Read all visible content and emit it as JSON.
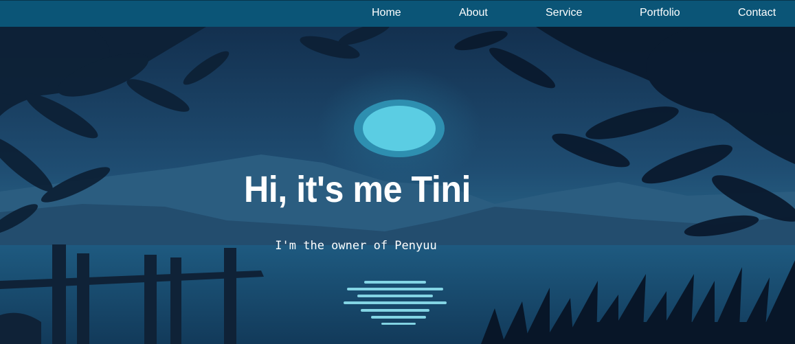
{
  "nav": {
    "items": [
      {
        "label": "Home"
      },
      {
        "label": "About"
      },
      {
        "label": "Service"
      },
      {
        "label": "Portfolio"
      },
      {
        "label": "Contact"
      }
    ]
  },
  "hero": {
    "title": "Hi, it's me Tini",
    "subtitle": "I'm the owner of Penyuu"
  },
  "colors": {
    "navbar": "#0b5577",
    "moon": "#5bcde3",
    "sky": "#1c4466",
    "water": "#1a4f73"
  }
}
